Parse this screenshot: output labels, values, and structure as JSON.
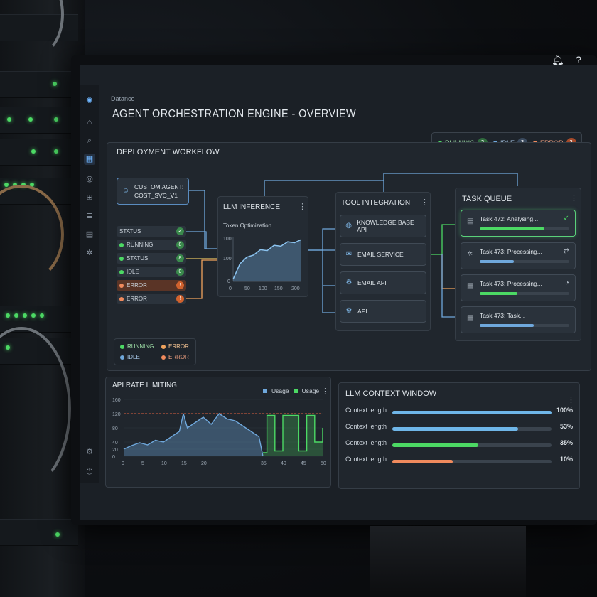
{
  "colors": {
    "running": "#4cd964",
    "idle": "#6fa8dc",
    "error": "#f08a5d",
    "accent": "#6fb6ff"
  },
  "app": {
    "name": "Datanco",
    "title": "AGENT ORCHESTRATION ENGINE - OVERVIEW"
  },
  "legend_top": [
    {
      "label": "RUNNING",
      "count": "2",
      "color": "#4cd964"
    },
    {
      "label": "IDLE",
      "count": "3",
      "color": "#6fa8dc"
    },
    {
      "label": "ERROR",
      "count": "2",
      "color": "#f08a5d"
    }
  ],
  "workflow": {
    "title": "DEPLOYMENT WORKFLOW",
    "agent_node": {
      "line1": "CUSTOM AGENT:",
      "line2": "COST_SVC_V1"
    },
    "status_rows": [
      {
        "label": "STATUS",
        "badge": "✓",
        "color": "#4cd964"
      },
      {
        "label": "RUNNING",
        "badge": "8",
        "color": "#4cd964"
      },
      {
        "label": "STATUS",
        "badge": "8",
        "color": "#4cd964"
      },
      {
        "label": "IDLE",
        "badge": "0",
        "color": "#4cd964"
      },
      {
        "label": "ERROR",
        "badge": "!",
        "color": "#f08a5d"
      },
      {
        "label": "ERROR",
        "badge": "!",
        "color": "#f08a5d"
      }
    ],
    "llm": {
      "title": "LLM INFERENCE",
      "subtitle": "Token Optimization",
      "y_ticks": [
        "100",
        "100",
        "0"
      ],
      "x_ticks": [
        "0",
        "50",
        "100",
        "150",
        "200"
      ]
    },
    "tools": {
      "title": "TOOL INTEGRATION",
      "items": [
        {
          "label": "KNOWLEDGE BASE API",
          "icon": "globe-icon"
        },
        {
          "label": "EMAIL SERVICE",
          "icon": "mail-icon"
        },
        {
          "label": "EMAIL API",
          "icon": "gear-icon"
        },
        {
          "label": "API",
          "icon": "gear-icon"
        }
      ]
    },
    "queue": {
      "title": "TASK QUEUE",
      "tasks": [
        {
          "label": "Task 472: Analysing...",
          "progress": 0.72,
          "status": "✓",
          "color": "#4cd964"
        },
        {
          "label": "Task 473: Processing...",
          "progress": 0.38,
          "status": "⇄",
          "color": "#6fa8dc"
        },
        {
          "label": "Task 473: Processing...",
          "progress": 0.42,
          "status": "◔",
          "color": "#4cd964"
        },
        {
          "label": "Task 473: Task...",
          "progress": 0.6,
          "status": "",
          "color": "#6fa8dc"
        }
      ]
    },
    "legend_bottom": [
      {
        "label": "RUNNING",
        "color": "#4cd964"
      },
      {
        "label": "ERROR",
        "color": "#f0a35d"
      },
      {
        "label": "IDLE",
        "color": "#6fa8dc"
      },
      {
        "label": "ERROR",
        "color": "#f08a5d"
      }
    ]
  },
  "rate_limiting": {
    "title": "API RATE LIMITING",
    "legend": [
      "Usage",
      "Usage"
    ]
  },
  "context_window": {
    "title": "LLM CONTEXT WINDOW",
    "rows": [
      {
        "label": "Context length",
        "value": 1.0,
        "pct": "100%",
        "color": "#6fb6e8"
      },
      {
        "label": "Context length",
        "value": 0.79,
        "pct": "53%",
        "color": "#6fb6e8"
      },
      {
        "label": "Context length",
        "value": 0.54,
        "pct": "35%",
        "color": "#4cd964"
      },
      {
        "label": "Context length",
        "value": 0.38,
        "pct": "10%",
        "color": "#f08a5d"
      }
    ]
  },
  "chart_data": [
    {
      "type": "area",
      "title": "Token Optimization",
      "x": [
        0,
        20,
        40,
        60,
        80,
        100,
        120,
        140,
        160,
        180,
        200
      ],
      "values": [
        5,
        40,
        55,
        60,
        72,
        70,
        82,
        80,
        90,
        88,
        95
      ],
      "xlim": [
        0,
        200
      ],
      "ylim": [
        0,
        100
      ],
      "x_ticks": [
        "0",
        "50",
        "100",
        "150",
        "200"
      ],
      "y_ticks": [
        "100",
        "100",
        "0"
      ]
    },
    {
      "type": "line",
      "title": "API RATE LIMITING",
      "x": [
        0,
        2,
        4,
        6,
        8,
        10,
        12,
        14,
        15,
        16,
        18,
        20,
        22,
        24,
        26,
        28,
        30,
        32,
        34,
        35,
        36,
        38,
        40,
        42,
        44,
        46,
        48,
        50
      ],
      "series": [
        {
          "name": "Usage",
          "color": "#6fa8dc",
          "values": [
            20,
            30,
            38,
            32,
            45,
            40,
            55,
            70,
            120,
            80,
            95,
            110,
            90,
            120,
            105,
            100,
            85,
            70,
            55,
            0,
            0,
            0,
            0,
            0,
            0,
            0,
            0,
            0
          ]
        },
        {
          "name": "Usage",
          "color": "#4cd964",
          "values": [
            0,
            0,
            0,
            0,
            0,
            0,
            0,
            0,
            0,
            0,
            0,
            0,
            0,
            0,
            0,
            0,
            0,
            0,
            0,
            10,
            115,
            15,
            115,
            115,
            15,
            115,
            40,
            80
          ]
        }
      ],
      "threshold": 120,
      "xlim": [
        0,
        50
      ],
      "ylim": [
        0,
        160
      ],
      "x_ticks": [
        "0",
        "5",
        "10",
        "15",
        "20",
        "35",
        "40",
        "45",
        "50"
      ],
      "y_ticks": [
        "160",
        "120",
        "80",
        "40",
        "20",
        "0"
      ]
    }
  ]
}
